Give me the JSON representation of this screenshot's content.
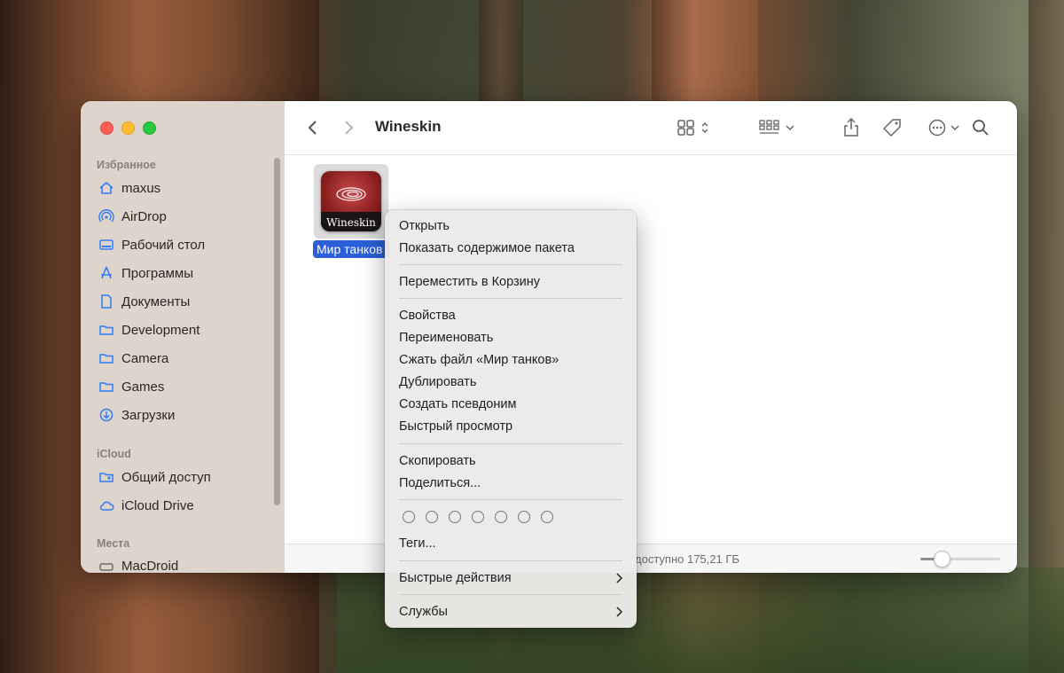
{
  "window": {
    "title": "Wineskin"
  },
  "sidebar": {
    "favorites_title": "Избранное",
    "favorites": [
      {
        "label": "maxus",
        "icon": "home-icon"
      },
      {
        "label": "AirDrop",
        "icon": "airdrop-icon"
      },
      {
        "label": "Рабочий стол",
        "icon": "desktop-icon"
      },
      {
        "label": "Программы",
        "icon": "applications-icon"
      },
      {
        "label": "Документы",
        "icon": "document-icon"
      },
      {
        "label": "Development",
        "icon": "folder-icon"
      },
      {
        "label": "Camera",
        "icon": "folder-icon"
      },
      {
        "label": "Games",
        "icon": "folder-icon"
      },
      {
        "label": "Загрузки",
        "icon": "download-icon"
      }
    ],
    "icloud_title": "iCloud",
    "icloud": [
      {
        "label": "Общий доступ",
        "icon": "shared-folder-icon"
      },
      {
        "label": "iCloud Drive",
        "icon": "cloud-icon"
      }
    ],
    "locations_title": "Места",
    "locations": [
      {
        "label": "MacDroid",
        "icon": "drive-icon"
      }
    ]
  },
  "file": {
    "name": "Мир танков",
    "icon_label": "Wineskin"
  },
  "status": {
    "text": "доступно 175,21 ГБ",
    "zoom_fraction": 0.25
  },
  "context_menu": {
    "open": "Открыть",
    "show_package": "Показать содержимое пакета",
    "move_to_trash": "Переместить в Корзину",
    "get_info": "Свойства",
    "rename": "Переименовать",
    "compress": "Сжать файл «Мир танков»",
    "duplicate": "Дублировать",
    "make_alias": "Создать псевдоним",
    "quick_look": "Быстрый просмотр",
    "copy": "Скопировать",
    "share": "Поделиться...",
    "tags": "Теги...",
    "quick_actions": "Быстрые действия",
    "services": "Службы",
    "tag_colors_count": 7
  },
  "colors": {
    "accent": "#2b5fd9",
    "sidebar_icon": "#2f7cf6"
  }
}
